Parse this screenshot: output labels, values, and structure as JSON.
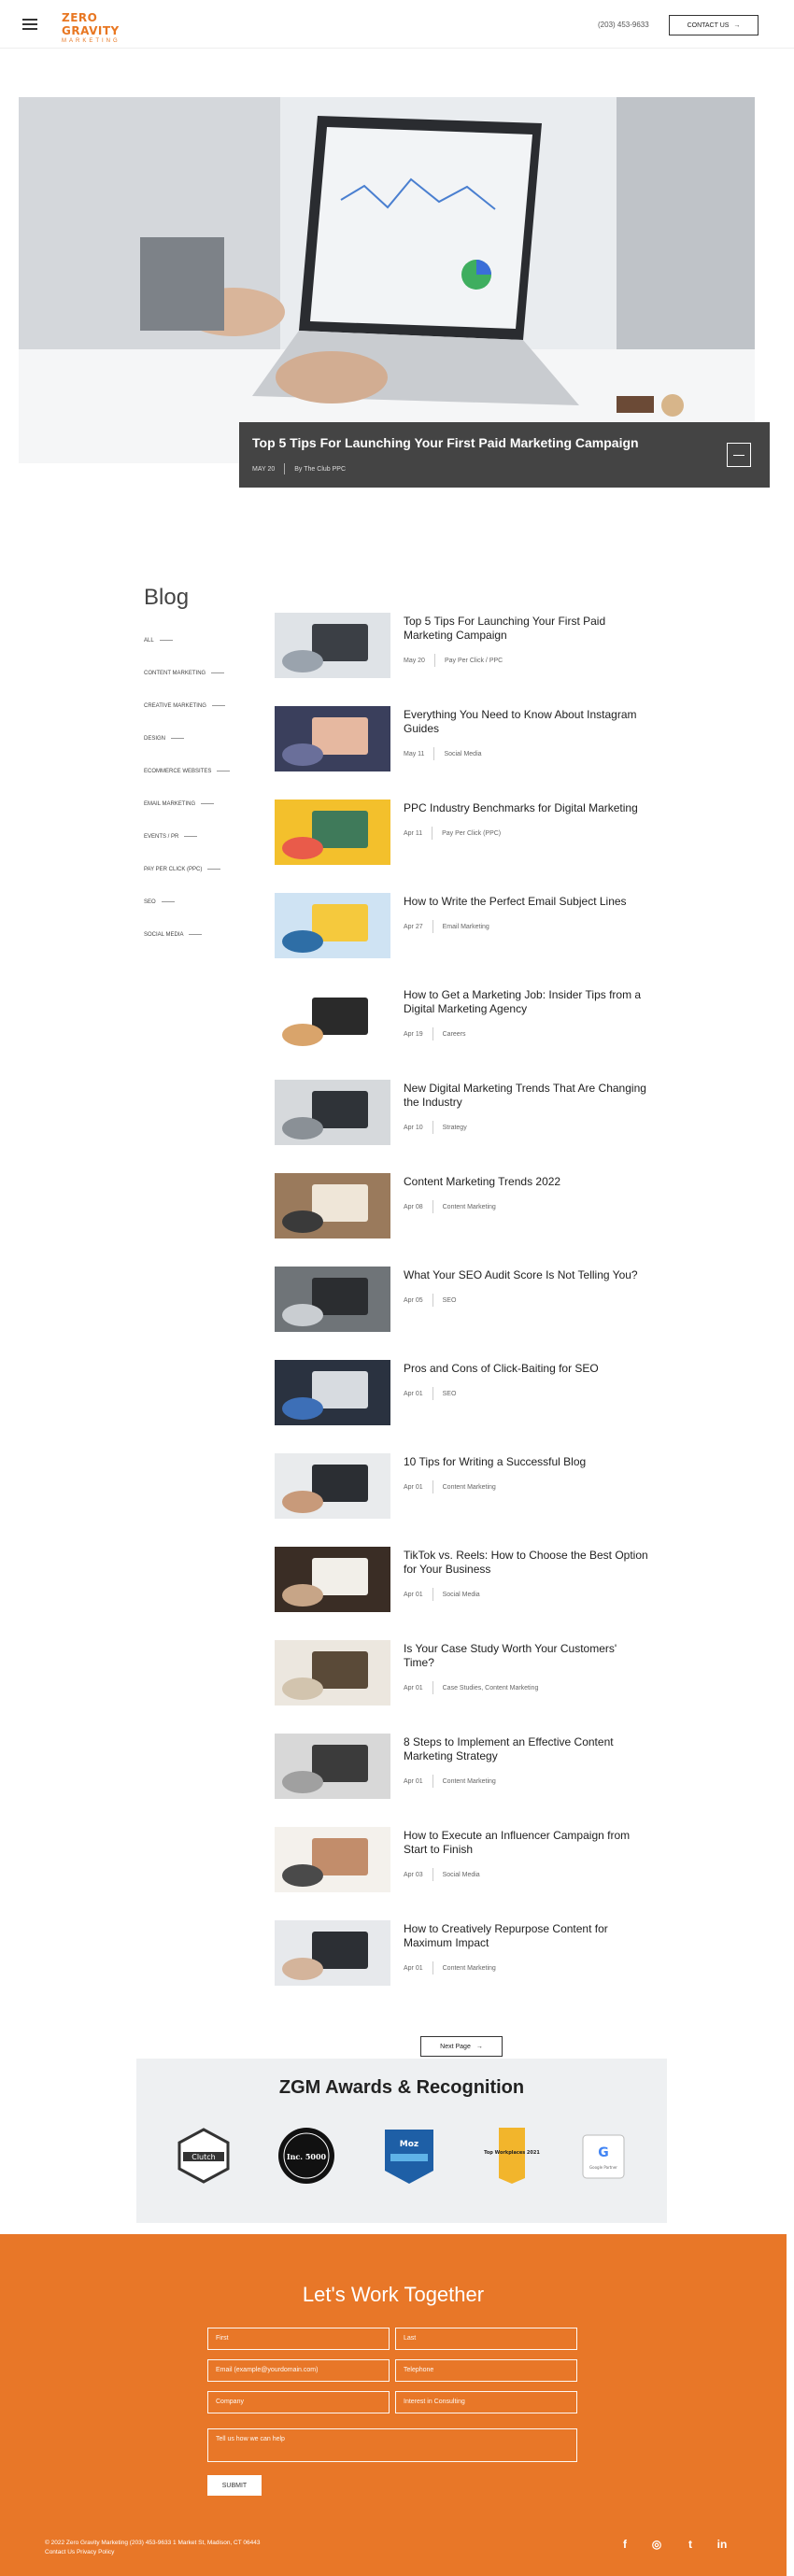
{
  "header": {
    "logo_title": "ZERO GRAVITY",
    "logo_sub": "MARKETING",
    "phone": "(203) 453-9633",
    "contact_label": "CONTACT US",
    "contact_arrow": "→"
  },
  "hero": {
    "title": "Top 5 Tips For Launching Your First Paid Marketing Campaign",
    "date": "MAY 20",
    "byline": "By The Club PPC",
    "colors": {
      "card": "#444444"
    }
  },
  "sidebar": {
    "heading": "Blog",
    "categories": [
      "All",
      "Content Marketing",
      "Creative Marketing",
      "Design",
      "Ecommerce Websites",
      "Email Marketing",
      "Events / PR",
      "Pay Per Click (PPC)",
      "SEO",
      "Social Media"
    ]
  },
  "posts": [
    {
      "title": "Top 5 Tips For Launching Your First Paid Marketing Campaign",
      "date": "May 20",
      "cat": "Pay Per Click / PPC"
    },
    {
      "title": "Everything You Need to Know About Instagram Guides",
      "date": "May 11",
      "cat": "Social Media"
    },
    {
      "title": "PPC Industry Benchmarks for Digital Marketing",
      "date": "Apr 11",
      "cat": "Pay Per Click (PPC)"
    },
    {
      "title": "How to Write the Perfect Email Subject Lines",
      "date": "Apr 27",
      "cat": "Email Marketing"
    },
    {
      "title": "How to Get a Marketing Job: Insider Tips from a Digital Marketing Agency",
      "date": "Apr 19",
      "cat": "Careers"
    },
    {
      "title": "New Digital Marketing Trends That Are Changing the Industry",
      "date": "Apr 10",
      "cat": "Strategy"
    },
    {
      "title": "Content Marketing Trends 2022",
      "date": "Apr 08",
      "cat": "Content Marketing"
    },
    {
      "title": "What Your SEO Audit Score Is Not Telling You?",
      "date": "Apr 05",
      "cat": "SEO"
    },
    {
      "title": "Pros and Cons of Click-Baiting for SEO",
      "date": "Apr 01",
      "cat": "SEO"
    },
    {
      "title": "10 Tips for Writing a Successful Blog",
      "date": "Apr 01",
      "cat": "Content Marketing"
    },
    {
      "title": "TikTok vs. Reels: How to Choose the Best Option for Your Business",
      "date": "Apr 01",
      "cat": "Social Media"
    },
    {
      "title": "Is Your Case Study Worth Your Customers' Time?",
      "date": "Apr 01",
      "cat": "Case Studies, Content Marketing"
    },
    {
      "title": "8 Steps to Implement an Effective Content Marketing Strategy",
      "date": "Apr 01",
      "cat": "Content Marketing"
    },
    {
      "title": "How to Execute an Influencer Campaign from Start to Finish",
      "date": "Apr 03",
      "cat": "Social Media"
    },
    {
      "title": "How to Creatively Repurpose Content for Maximum Impact",
      "date": "Apr 01",
      "cat": "Content Marketing"
    }
  ],
  "next_page": {
    "label": "Next Page",
    "arrow": "→"
  },
  "awards": {
    "heading": "ZGM Awards & Recognition",
    "badges": [
      "Clutch",
      "Inc. 5000",
      "Moz",
      "Top Workplaces 2021",
      "Google Partner"
    ]
  },
  "contact": {
    "heading": "Let's Work Together",
    "fields": [
      "First",
      "Last",
      "Email (example@yourdomain.com)",
      "Telephone",
      "Company",
      "Interest in Consulting",
      "Tell us how we can help"
    ],
    "submit": "SUBMIT"
  },
  "footer": {
    "line1": "© 2022 Zero Gravity Marketing  (203) 453-9633  1 Market St, Madison, CT 06443",
    "line2": "Contact Us  Privacy Policy",
    "social": [
      "f",
      "◎",
      "t",
      "in"
    ]
  }
}
